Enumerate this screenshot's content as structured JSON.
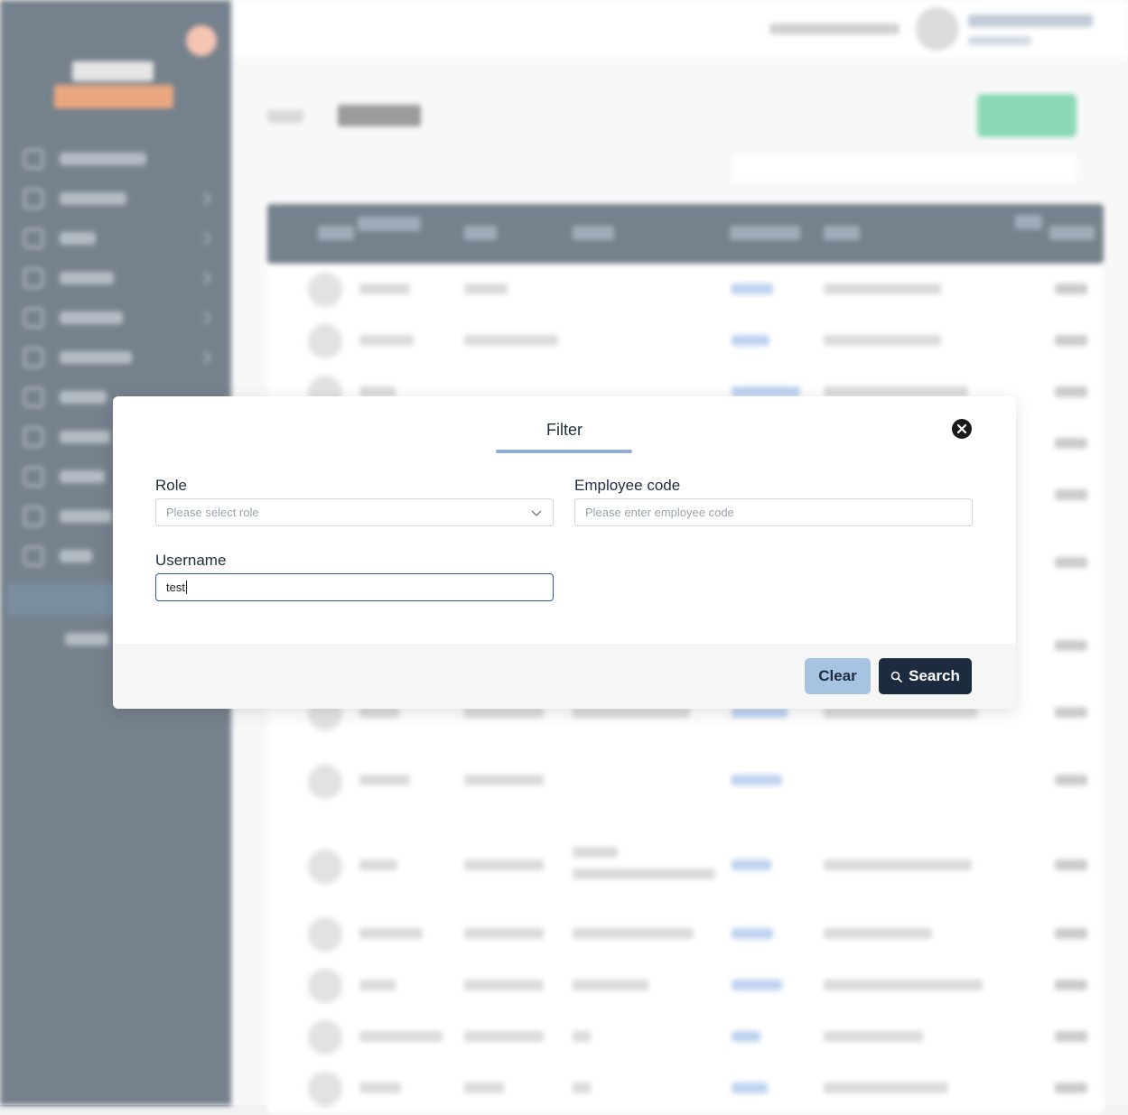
{
  "modal": {
    "title": "Filter",
    "close_icon": "close-circle-icon",
    "fields": {
      "role": {
        "label": "Role",
        "placeholder": "Please select role",
        "icon": "chevron-down-icon"
      },
      "employee_code": {
        "label": "Employee code",
        "placeholder": "Please enter employee code"
      },
      "username": {
        "label": "Username",
        "value": "test"
      }
    },
    "buttons": {
      "clear": "Clear",
      "search": "Search",
      "search_icon": "search-icon"
    }
  },
  "colors": {
    "sidebar": "#2c3e50",
    "primary_dark": "#1c2b3f",
    "clear_button": "#a6c4e2",
    "add_button": "#4cc38a",
    "focus_border": "#2c5aa0"
  }
}
